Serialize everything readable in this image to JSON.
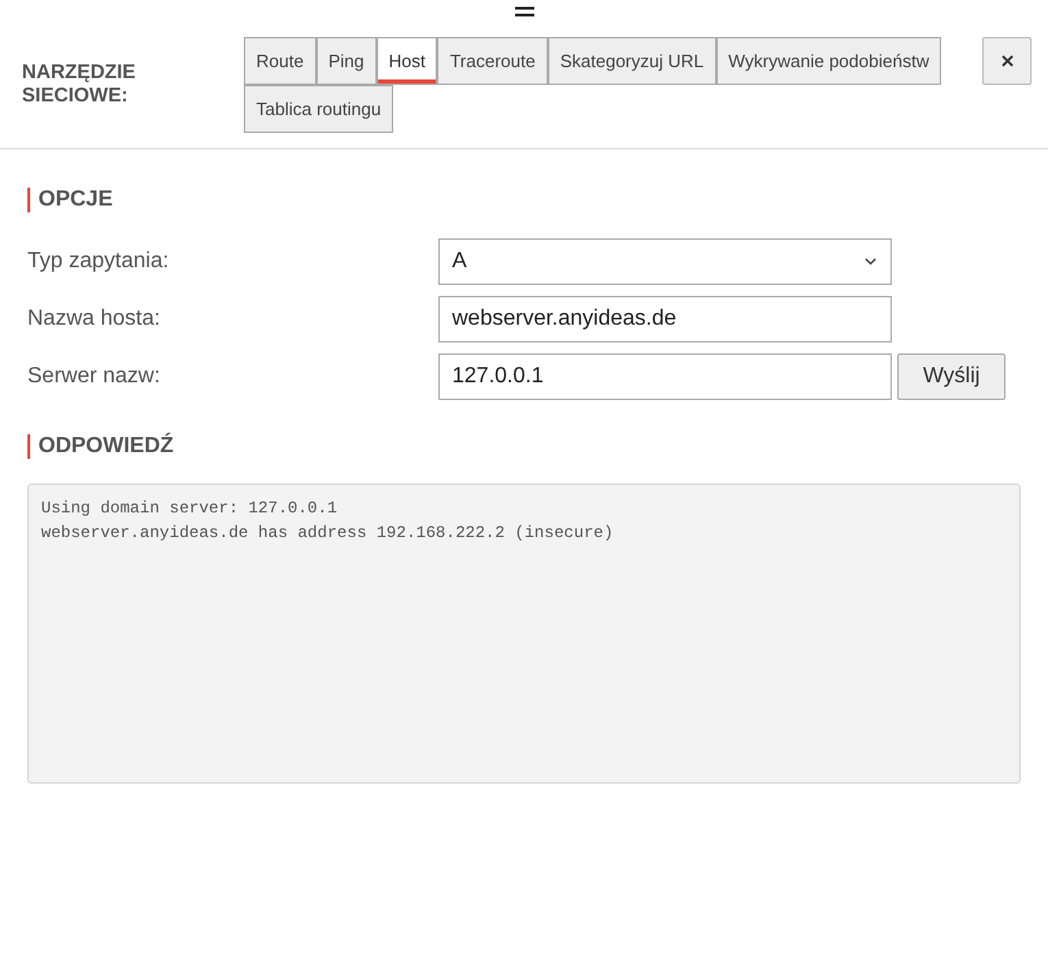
{
  "header": {
    "title": "NARZĘDZIE SIECIOWE:"
  },
  "tabs": [
    {
      "label": "Route",
      "selected": false
    },
    {
      "label": "Ping",
      "selected": false
    },
    {
      "label": "Host",
      "selected": true
    },
    {
      "label": "Traceroute",
      "selected": false
    },
    {
      "label": "Skategoryzuj URL",
      "selected": false
    },
    {
      "label": "Wykrywanie podobieństw",
      "selected": false
    },
    {
      "label": "Tablica routingu",
      "selected": false
    }
  ],
  "options": {
    "title": "OPCJE",
    "fields": [
      {
        "kind": "select",
        "label": "Typ zapytania:",
        "value": "A"
      },
      {
        "kind": "input",
        "label": "Nazwa hosta:",
        "value": "webserver.anyideas.de"
      },
      {
        "kind": "input",
        "label": "Serwer nazw:",
        "value": "127.0.0.1",
        "button": "Wyślij"
      }
    ]
  },
  "response": {
    "title": "ODPOWIEDŹ",
    "lines": [
      "Using domain server: 127.0.0.1",
      "webserver.anyideas.de has address 192.168.222.2 (insecure)"
    ]
  }
}
